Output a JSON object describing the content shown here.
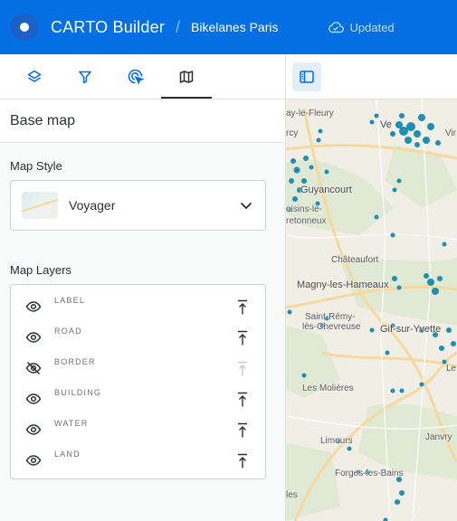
{
  "header": {
    "app_title": "CARTO Builder",
    "separator": "/",
    "map_name": "Bikelanes Paris",
    "status": "Updated"
  },
  "tabs": [
    {
      "name": "layers",
      "icon": "layers-icon"
    },
    {
      "name": "filters",
      "icon": "filter-icon"
    },
    {
      "name": "interactions",
      "icon": "cursor-target-icon"
    },
    {
      "name": "basemap",
      "icon": "map-icon",
      "active": true
    }
  ],
  "panel": {
    "title": "Base map",
    "map_style_label": "Map Style",
    "map_style_value": "Voyager",
    "map_layers_label": "Map Layers",
    "layers": [
      {
        "name": "LABEL",
        "visible": true,
        "icon": "eye-icon"
      },
      {
        "name": "ROAD",
        "visible": true,
        "icon": "eye-icon"
      },
      {
        "name": "BORDER",
        "visible": false,
        "icon": "eye-off-icon"
      },
      {
        "name": "BUILDING",
        "visible": true,
        "icon": "eye-icon"
      },
      {
        "name": "WATER",
        "visible": true,
        "icon": "eye-icon"
      },
      {
        "name": "LAND",
        "visible": true,
        "icon": "eye-icon"
      }
    ]
  },
  "map": {
    "places": [
      "ay-le-Fleury",
      "Ve",
      "Vir",
      "rcy",
      "Guyancourt",
      "oisins-le-",
      "retonneux",
      "Châteaufort",
      "Magny-les-Hameaux",
      "Saint-Rémy-",
      "lès-Chevreuse",
      "Gif-sur-Yvette",
      "Le",
      "Les Molières",
      "Limours",
      "Janvry",
      "Forges-les-Bains",
      "les"
    ],
    "colors": {
      "points": "#1d8fb3",
      "header": "#036fe2"
    }
  }
}
